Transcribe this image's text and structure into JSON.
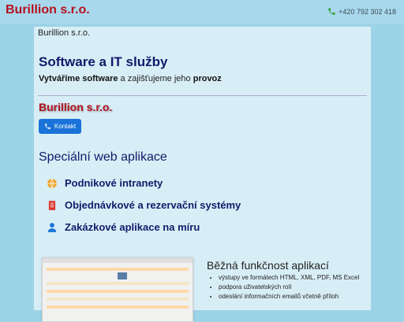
{
  "header": {
    "brand": "Burillion s.r.o.",
    "phone": "+420 792 302 418"
  },
  "main": {
    "breadcrumb": "Burillion s.r.o.",
    "title": "Software a IT služby",
    "tagline": {
      "part1": "Vytváříme software",
      "part2": " a zajišťujeme jeho ",
      "part3": "provoz"
    },
    "company": "Burillion s.r.o.",
    "contact_button": "Kontakt",
    "section_title": "Speciální web aplikace",
    "features": [
      {
        "icon": "globe-icon",
        "label": "Podnikové intranety"
      },
      {
        "icon": "document-icon",
        "label": "Objednávkové a rezervační systémy"
      },
      {
        "icon": "user-icon",
        "label": "Zakázkové aplikace na míru"
      }
    ],
    "common_title": "Běžná funkčnost aplikací",
    "common_items": [
      "výstupy ve formátech HTML, XML, PDF, MS Excel",
      "podpora uživatelských rolí",
      "odeslání informačních emailů včetně příloh"
    ]
  },
  "colors": {
    "brand": "#b3121f",
    "heading": "#111a6a",
    "button": "#1a73d9",
    "background": "#9dd3e6",
    "icon_accent": "#f0a020"
  }
}
